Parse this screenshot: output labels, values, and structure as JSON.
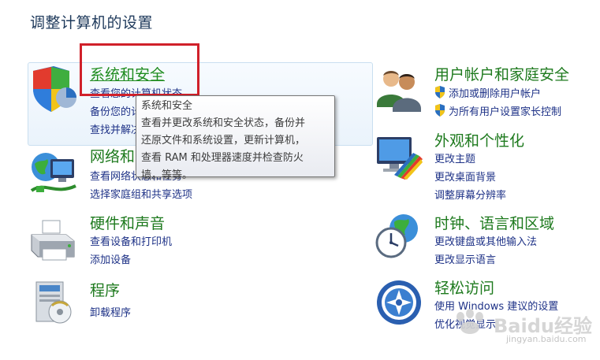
{
  "page_title": "调整计算机的设置",
  "left_categories": [
    {
      "name": "系统和安全",
      "icon": "shield-flag-icon",
      "links": [
        "查看您的计算机状态",
        "备份您的计算机",
        "查找并解决问题"
      ]
    },
    {
      "name": "网络和 Internet",
      "icon": "network-globe-icon",
      "links": [
        "查看网络状态和任务",
        "选择家庭组和共享选项"
      ]
    },
    {
      "name": "硬件和声音",
      "icon": "printer-icon",
      "links": [
        "查看设备和打印机",
        "添加设备"
      ]
    },
    {
      "name": "程序",
      "icon": "programs-icon",
      "links": [
        "卸载程序"
      ]
    }
  ],
  "right_categories": [
    {
      "name": "用户帐户和家庭安全",
      "icon": "users-icon",
      "links": [
        "添加或删除用户帐户",
        "为所有用户设置家长控制"
      ]
    },
    {
      "name": "外观和个性化",
      "icon": "monitor-palette-icon",
      "links": [
        "更改主题",
        "更改桌面背景",
        "调整屏幕分辨率"
      ]
    },
    {
      "name": "时钟、语言和区域",
      "icon": "clock-globe-icon",
      "links": [
        "更改键盘或其他输入法",
        "更改显示语言"
      ]
    },
    {
      "name": "轻松访问",
      "icon": "accessibility-icon",
      "links": [
        "使用 Windows 建议的设置",
        "优化视觉显示"
      ]
    }
  ],
  "tooltip": {
    "lines": [
      "系统和安全",
      "查看并更改系统和安全状态，备份并",
      "还原文件和系统设置，更新计算机，",
      "查看 RAM 和处理器速度并检查防火",
      "墙，等等。"
    ]
  },
  "watermark": {
    "text": "Baidu经验",
    "url": "jingyan.baidu.com"
  },
  "colors": {
    "category_title": "#1e7a1e",
    "link": "#1e3287",
    "highlight": "#d0202a"
  }
}
